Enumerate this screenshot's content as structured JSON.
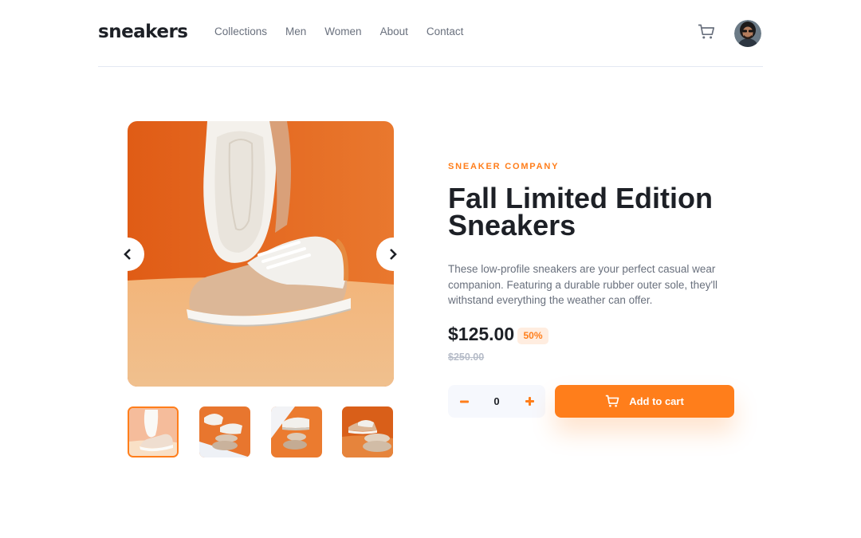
{
  "brand": {
    "logo": "sneakers"
  },
  "nav": [
    "Collections",
    "Men",
    "Women",
    "About",
    "Contact"
  ],
  "header": {
    "cart_icon": "cart-icon",
    "avatar_icon": "user-avatar"
  },
  "gallery": {
    "main_image": "white and tan leather sneakers on orange background",
    "prev_icon": "chevron-left-icon",
    "next_icon": "chevron-right-icon",
    "active_thumbnail": 0,
    "thumbnail_count": 4
  },
  "product": {
    "company": "SNEAKER COMPANY",
    "title": "Fall Limited Edition Sneakers",
    "description": "These low-profile sneakers are your perfect casual wear companion. Featuring a durable rubber outer sole, they'll withstand everything the weather can offer.",
    "price": "$125.00",
    "discount": "50%",
    "original_price": "$250.00"
  },
  "cart_controls": {
    "quantity": "0",
    "minus_icon": "minus-icon",
    "plus_icon": "plus-icon",
    "add_label": "Add to cart",
    "add_icon": "cart-icon"
  },
  "colors": {
    "accent": "#ff7e1b",
    "accent_pale": "#ffede0",
    "dark": "#1d2026",
    "grey": "#69707d",
    "light_grey": "#b6bcc8",
    "qty_bg": "#f6f8fd"
  }
}
